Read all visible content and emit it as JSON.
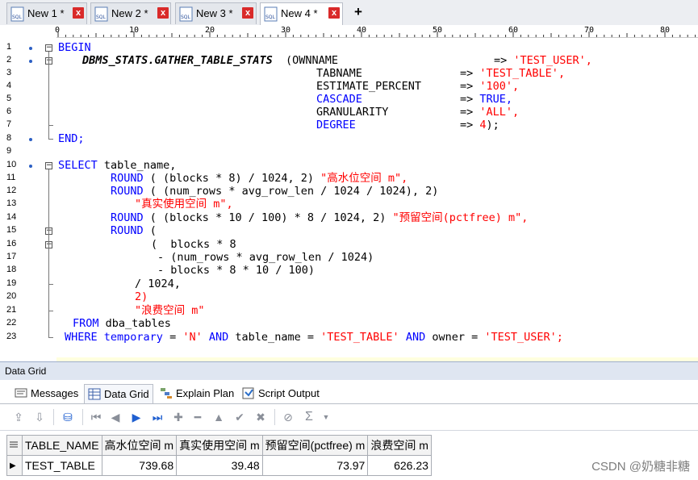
{
  "tabs": [
    {
      "label": "New 1 *",
      "active": false
    },
    {
      "label": "New 2 *",
      "active": false
    },
    {
      "label": "New 3 *",
      "active": false
    },
    {
      "label": "New 4 *",
      "active": true
    }
  ],
  "new_tab_symbol": "+",
  "close_symbol": "x",
  "ruler_marks": [
    "0",
    "10",
    "20",
    "30",
    "40",
    "50",
    "60",
    "70",
    "80"
  ],
  "line_numbers": [
    "1",
    "2",
    "3",
    "4",
    "5",
    "6",
    "7",
    "8",
    "9",
    "10",
    "11",
    "12",
    "13",
    "14",
    "15",
    "16",
    "17",
    "18",
    "19",
    "20",
    "21",
    "22",
    "23"
  ],
  "code": {
    "l1": "BEGIN",
    "l2_fn": "DBMS_STATS.GATHER_TABLE_STATS",
    "l2_open": "(",
    "l2_param": "OWNNAME",
    "l2_arrow": "=>",
    "l2_val": "'TEST_USER',",
    "l3_param": "TABNAME",
    "l3_arrow": "=>",
    "l3_val": "'TEST_TABLE',",
    "l4_param": "ESTIMATE_PERCENT",
    "l4_arrow": "=>",
    "l4_val": "'100',",
    "l5_param": "CASCADE",
    "l5_arrow": "=>",
    "l5_val": "TRUE,",
    "l6_param": "GRANULARITY",
    "l6_arrow": "=>",
    "l6_val": "'ALL',",
    "l7_param": "DEGREE",
    "l7_arrow": "=>",
    "l7_val": "4",
    "l7_end": ");",
    "l8": "END;",
    "l10_kw": "SELECT",
    "l10_rest": "table_name,",
    "l11_kw": "ROUND",
    "l11_a": "( (blocks",
    "l11_b": "* 8) / 1024, 2)",
    "l11_alias": "\"高水位空间 m\",",
    "l12_kw": "ROUND",
    "l12_a": "( (num_rows * avg_row_len / 1024 / 1024), 2)",
    "l13_alias": "\"真实使用空间 m\",",
    "l14_kw": "ROUND",
    "l14_a": "( (blocks",
    "l14_b": "* 10 / 100) * 8 / 1024, 2)",
    "l14_alias": "\"预留空间(pctfree) m\",",
    "l15_kw": "ROUND",
    "l15_a": "(",
    "l16": "(  blocks * 8",
    "l17": "- (num_rows * avg_row_len / 1024)",
    "l18": "- blocks * 8 * 10 / 100)",
    "l19": "/ 1024,",
    "l20": "2)",
    "l21_alias": "\"浪费空间 m\"",
    "l22_kw": "FROM",
    "l22_rest": "dba_tables",
    "l23_kw": "WHERE",
    "l23_col": "temporary",
    "l23_eq": "=",
    "l23_v1": "'N'",
    "l23_and": "AND",
    "l23_col2": "table_name",
    "l23_v2": "'TEST_TABLE'",
    "l23_and2": "AND",
    "l23_col3": "owner",
    "l23_v3": "'TEST_USER';"
  },
  "data_grid": {
    "title": "Data Grid",
    "subtabs": [
      "Messages",
      "Data Grid",
      "Explain Plan",
      "Script Output"
    ],
    "active_subtab": "Data Grid",
    "columns": [
      "TABLE_NAME",
      "高水位空间 m",
      "真实使用空间 m",
      "预留空间(pctfree) m",
      "浪费空间 m"
    ],
    "rows": [
      [
        "TEST_TABLE",
        "739.68",
        "39.48",
        "73.97",
        "626.23"
      ]
    ],
    "row_indicator": "▶",
    "sigma": "Σ"
  },
  "watermark": "CSDN @奶糖非糖",
  "colors": {
    "keyword": "#0000ff",
    "string": "#ff0000",
    "current_line": "#ffffdf",
    "panel_header": "#dfe6f1"
  }
}
